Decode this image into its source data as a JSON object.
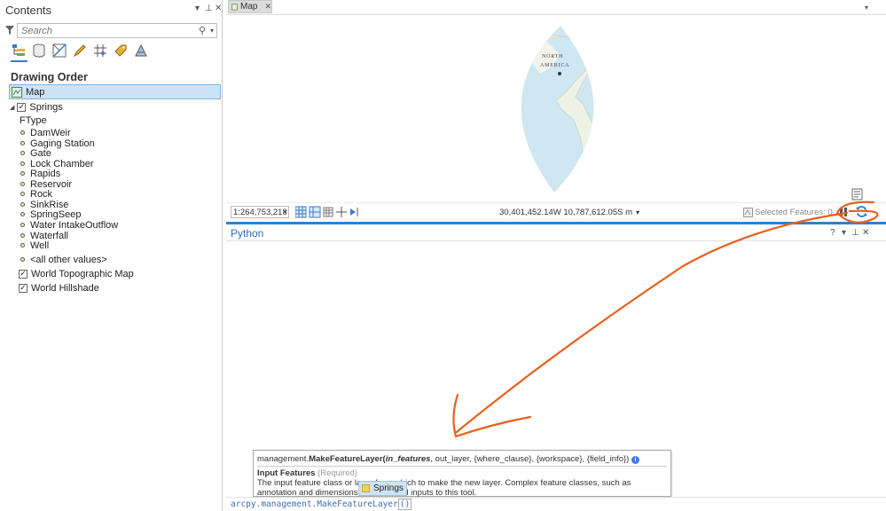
{
  "contents": {
    "title": "Contents",
    "controls": [
      "▾",
      "⊥",
      "✕"
    ],
    "search_placeholder": "Search",
    "section_title": "Drawing Order",
    "map_label": "Map",
    "layers": {
      "springs": "Springs",
      "field_label": "FType",
      "values": [
        "DamWeir",
        "Gaging Station",
        "Gate",
        "Lock Chamber",
        "Rapids",
        "Reservoir",
        "Rock",
        "SinkRise",
        "SpringSeep",
        "Water IntakeOutflow",
        "Waterfall",
        "Well"
      ],
      "other_values": "<all other values>",
      "topo": "World Topographic Map",
      "hillshade": "World Hillshade"
    }
  },
  "map_view": {
    "tab_label": "Map",
    "map_label_line1": "NORTH",
    "map_label_line2": "AMERICA",
    "scale": "1:264,753,218",
    "coordinates": "30,401,452.14W 10,787,612.05S m",
    "selected_features": "Selected Features: 0"
  },
  "python": {
    "title": "Python",
    "controls": [
      "?",
      "▾",
      "⊥",
      "✕"
    ],
    "signature_prefix": "management.",
    "signature_func": "MakeFeatureLayer(",
    "signature_param": "in_features",
    "signature_rest": ", out_layer, {where_clause}, {workspace}, {field_info})",
    "param_name": "Input Features",
    "param_required": "(Required)",
    "param_desc": "The input feature class or layer from which to make the new layer. Complex feature classes, such as annotation and dimensions, are not valid inputs to this tool.",
    "autocomplete_item": "Springs",
    "input_line": "arcpy.management.MakeFeatureLayer",
    "input_paren": "()"
  },
  "colors": {
    "accent_blue": "#2f7fd1",
    "annotation_orange": "#e8601c",
    "ocean": "#cfe6f3"
  }
}
